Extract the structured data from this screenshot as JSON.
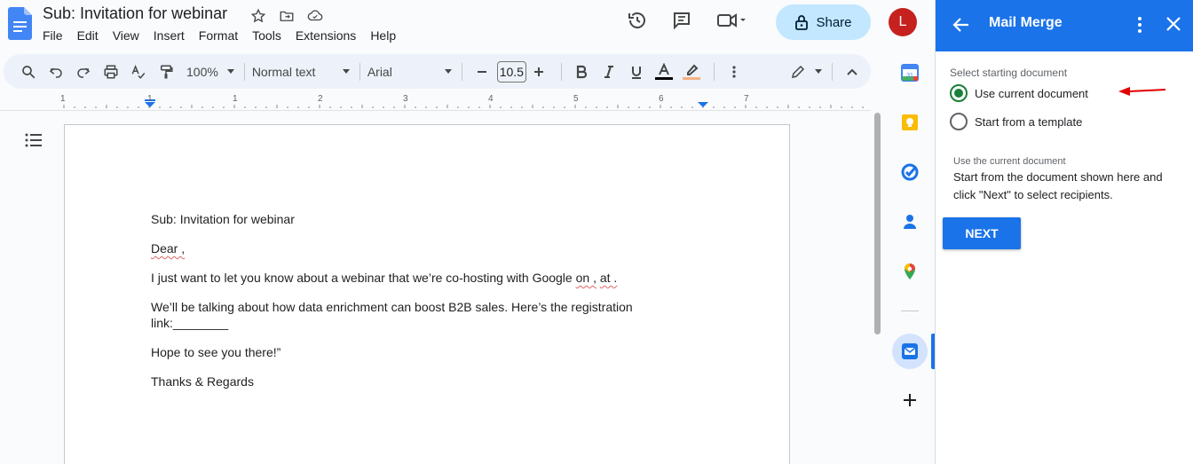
{
  "header": {
    "doc_title": "Sub: Invitation for webinar",
    "menu": [
      "File",
      "Edit",
      "View",
      "Insert",
      "Format",
      "Tools",
      "Extensions",
      "Help"
    ],
    "share_label": "Share",
    "avatar_initial": "L"
  },
  "toolbar": {
    "zoom": "100%",
    "style": "Normal text",
    "font": "Arial",
    "font_size": "10.5"
  },
  "ruler": {
    "marks": [
      "1",
      "1",
      "1",
      "2",
      "3",
      "4",
      "5",
      "6",
      "7"
    ]
  },
  "document": {
    "subject": "Sub: Invitation for webinar",
    "greeting": "Dear ,",
    "line1_prefix": "I just want to let you know about a webinar that we’re co-hosting with Google ",
    "line1_on": "on ,",
    "line1_at": "at .",
    "line2": "We’ll be talking about how data enrichment can boost B2B sales. Here’s the registration link:________",
    "line3": "Hope to see you there!”",
    "signoff": "Thanks & Regards"
  },
  "panel": {
    "title": "Mail Merge",
    "section_label": "Select starting document",
    "option_current": "Use current document",
    "option_template": "Start from a template",
    "help_label": "Use the current document",
    "help_text": "Start from the document shown here and click \"Next\" to select recipients.",
    "next_label": "NEXT"
  },
  "colors": {
    "accent": "#1a73e8",
    "share_bg": "#c2e7ff",
    "radio_checked": "#188038",
    "avatar_bg": "#c5221f",
    "annotation_arrow": "#e00000"
  }
}
